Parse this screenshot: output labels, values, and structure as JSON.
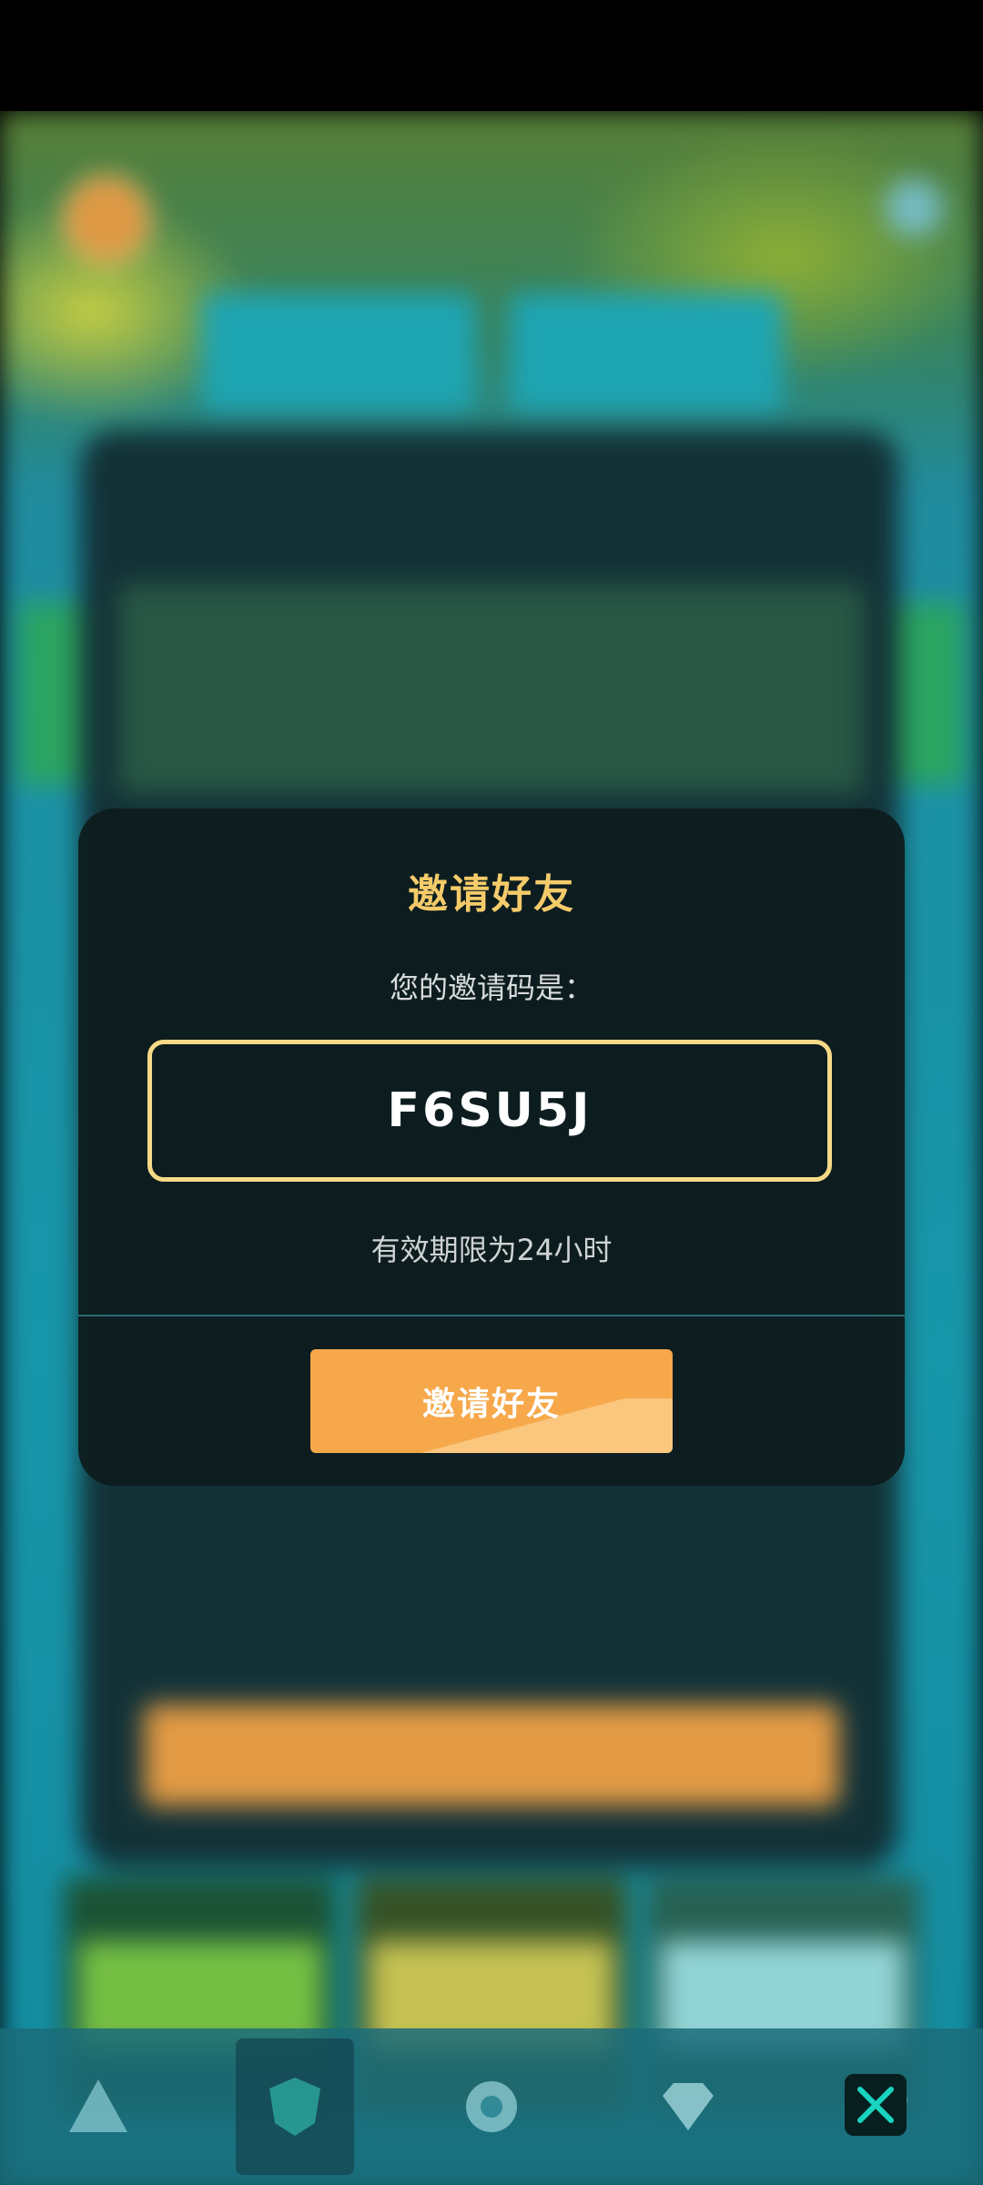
{
  "modal": {
    "title": "邀请好友",
    "subtitle": "您的邀请码是：",
    "invite_code": "F6SU5J",
    "validity_note": "有效期限为24小时",
    "invite_button_label": "邀请好友"
  },
  "bottom_nav": {
    "items": [
      {
        "icon": "triangle-icon"
      },
      {
        "icon": "shield-icon",
        "active": true
      },
      {
        "icon": "gear-icon"
      },
      {
        "icon": "diamond-icon"
      },
      {
        "icon": "heart-icon"
      }
    ]
  },
  "close_button": {
    "icon": "close-icon"
  },
  "colors": {
    "accent_gold": "#f5cb6a",
    "code_border": "#f6d987",
    "button_orange": "#f6a84a",
    "modal_bg": "#0e1c1e",
    "close_x": "#18d4c0"
  }
}
